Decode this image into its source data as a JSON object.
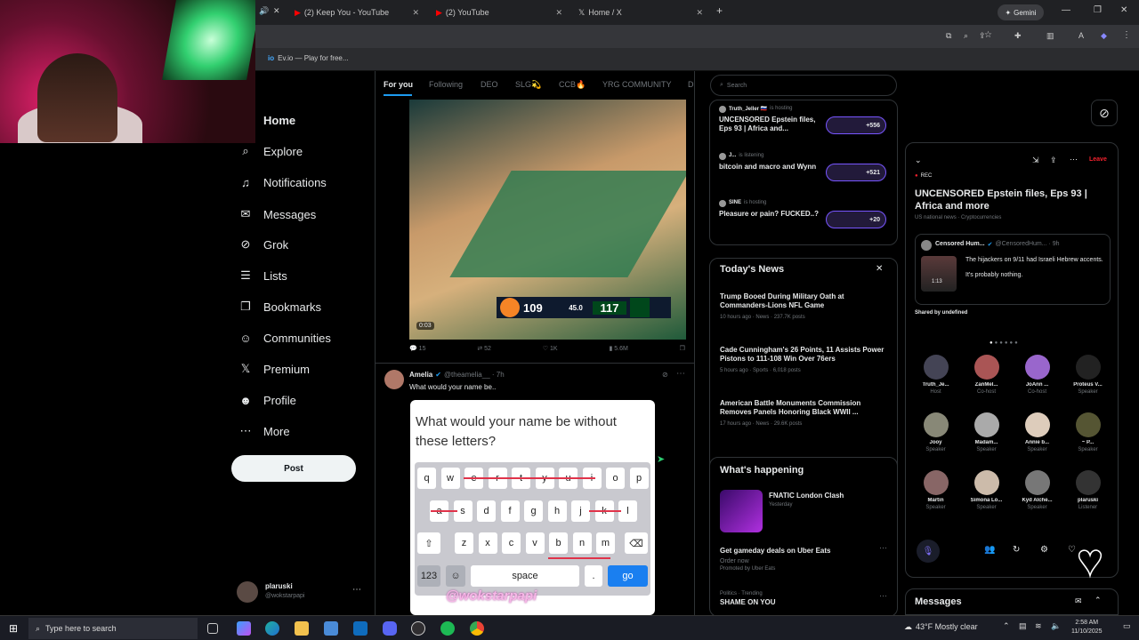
{
  "browser": {
    "tabs": [
      {
        "label": "(2) Keep You - YouTube"
      },
      {
        "label": "(2) YouTube"
      },
      {
        "label": "Home / X"
      }
    ],
    "gemini_label": "Gemini",
    "bookmark": "Ev.io — Play for free..."
  },
  "sidebar": {
    "items": [
      {
        "label": "Home",
        "icon": "home-icon",
        "glyph": ""
      },
      {
        "label": "Explore",
        "icon": "search-icon",
        "glyph": "⌕"
      },
      {
        "label": "Notifications",
        "icon": "bell-icon",
        "glyph": "♫"
      },
      {
        "label": "Messages",
        "icon": "mail-icon",
        "glyph": "✉"
      },
      {
        "label": "Grok",
        "icon": "grok-icon",
        "glyph": "⊘"
      },
      {
        "label": "Lists",
        "icon": "list-icon",
        "glyph": "☰"
      },
      {
        "label": "Bookmarks",
        "icon": "bookmark-icon",
        "glyph": "❐"
      },
      {
        "label": "Communities",
        "icon": "communities-icon",
        "glyph": "☺"
      },
      {
        "label": "Premium",
        "icon": "x-icon",
        "glyph": "𝕏"
      },
      {
        "label": "Profile",
        "icon": "person-icon",
        "glyph": "☻"
      },
      {
        "label": "More",
        "icon": "more-icon",
        "glyph": "⋯"
      }
    ],
    "post_label": "Post",
    "account": {
      "name": "plaruski",
      "handle": "@wokstarpapi"
    }
  },
  "feed": {
    "tabs": [
      "For you",
      "Following",
      "DEO",
      "SLG💫",
      "CCB🔥",
      "YRG COMMUNITY",
      "D"
    ],
    "video": {
      "score_left": "109",
      "score_right": "117",
      "clock": "45.0",
      "duration": "0:03"
    },
    "post1_metrics": {
      "replies": "15",
      "reposts": "52",
      "likes": "1K",
      "views": "5.6M"
    },
    "post2": {
      "name": "Amelia",
      "handle": "@theamelia__ · 7h",
      "text": "What would your name be..",
      "image_question": "What would your name be without these letters?",
      "watermark": "@wokstarpapi",
      "keys_row1": [
        "q",
        "w",
        "e",
        "r",
        "t",
        "y",
        "u",
        "i",
        "o",
        "p"
      ],
      "keys_row2": [
        "a",
        "s",
        "d",
        "f",
        "g",
        "h",
        "j",
        "k",
        "l"
      ],
      "keys_row3": [
        "z",
        "x",
        "c",
        "v",
        "b",
        "n",
        "m"
      ],
      "space": "space",
      "num": "123",
      "go": "go"
    }
  },
  "right": {
    "search_placeholder": "Search",
    "spaces": [
      {
        "host": "Truth_Jeller 🇷🇺",
        "status": "is hosting",
        "title": "UNCENSORED Epstein files, Eps 93 | Africa and...",
        "count": "+556"
      },
      {
        "host": "J...",
        "status": "is listening",
        "title": "bitcoin and macro and Wynn",
        "count": "+521"
      },
      {
        "host": "SINE",
        "status": "is hosting",
        "title": "Pleasure or pain? FUCKED..?",
        "count": "+20"
      }
    ],
    "todays_news_title": "Today's News",
    "news": [
      {
        "headline": "Trump Booed During Military Oath at Commanders-Lions NFL Game",
        "meta": "10 hours ago · News · 237.7K posts"
      },
      {
        "headline": "Cade Cunningham's 26 Points, 11 Assists Power Pistons to 111-108 Win Over 76ers",
        "meta": "5 hours ago · Sports · 6,018 posts"
      },
      {
        "headline": "American Battle Monuments Commission Removes Panels Honoring Black WWII ...",
        "meta": "17 hours ago · News · 29.6K posts"
      }
    ],
    "happening_title": "What's happening",
    "happening": [
      {
        "title": "FNATIC London Clash",
        "meta": "Yesterday"
      },
      {
        "title": "Get gameday deals on Uber Eats",
        "meta": "Order now",
        "promo": "Promoted by Uber Eats"
      },
      {
        "title": "SHAME ON YOU",
        "meta": "Politics · Trending"
      }
    ]
  },
  "space_panel": {
    "rec": "REC",
    "leave": "Leave",
    "title": "UNCENSORED Epstein files, Eps 93 | Africa and more",
    "subtitle": "US national news · Cryptocurrencies",
    "tweet": {
      "name": "Censored Hum...",
      "handle": "@CensoredHum... · 9h",
      "line1": "The hijackers on 9/11 had Israeli Hebrew accents.",
      "line2": "It's probably nothing.",
      "duration": "1:13"
    },
    "shared_by": "Shared by undefined",
    "speakers": [
      {
        "name": "Truth_Je...",
        "role": "Host"
      },
      {
        "name": "ZanMel...",
        "role": "Co-host"
      },
      {
        "name": "JoAnn ...",
        "role": "Co-host"
      },
      {
        "name": "Proteus V...",
        "role": "Speaker"
      },
      {
        "name": "Jooy",
        "role": "Speaker"
      },
      {
        "name": "Madam...",
        "role": "Speaker"
      },
      {
        "name": "Annie b...",
        "role": "Speaker"
      },
      {
        "name": "~ P...",
        "role": "Speaker"
      },
      {
        "name": "Martin",
        "role": "Speaker"
      },
      {
        "name": "Simona Lo...",
        "role": "Speaker"
      },
      {
        "name": "Kyd Alche...",
        "role": "Speaker"
      },
      {
        "name": "plaruski",
        "role": "Listener"
      }
    ],
    "messages_title": "Messages"
  },
  "taskbar": {
    "search": "Type here to search",
    "weather": "43°F  Mostly clear",
    "time": "2:58 AM",
    "date": "11/10/2025"
  }
}
